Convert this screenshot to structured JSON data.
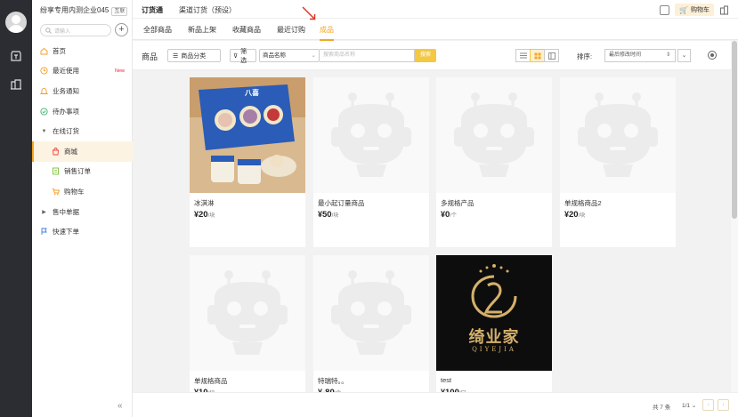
{
  "rail": {
    "icons": [
      "avatar",
      "order-icon",
      "building-icon"
    ]
  },
  "sidebar": {
    "company": "纷享专用内测企业045",
    "company_tag": "互联",
    "search_placeholder": "请输入",
    "add": "+",
    "items": [
      {
        "label": "首页",
        "icon": "home-icon"
      },
      {
        "label": "最近使用",
        "icon": "clock-icon",
        "badge": "New"
      },
      {
        "label": "业务通知",
        "icon": "bell-icon"
      },
      {
        "label": "待办事项",
        "icon": "check-icon"
      },
      {
        "label": "在线订货",
        "icon": "caret-down-icon"
      },
      {
        "label": "商城",
        "icon": "shop-icon"
      },
      {
        "label": "销售订单",
        "icon": "document-icon"
      },
      {
        "label": "购物车",
        "icon": "cart-icon"
      },
      {
        "label": "售中单据",
        "icon": "caret-right-icon"
      },
      {
        "label": "快速下单",
        "icon": "flag-icon"
      }
    ],
    "collapse": "«"
  },
  "header": {
    "app_name": "订货通",
    "channel": "渠道订货（预设）",
    "cart_label": "购物车"
  },
  "tabs": [
    "全部商品",
    "新品上架",
    "收藏商品",
    "最近订购",
    "成品"
  ],
  "toolbar": {
    "title": "商品",
    "category_btn": "商品分类",
    "filter_btn": "筛选",
    "field_select": "商品名称",
    "search_placeholder": "搜索商品名称",
    "search_btn": "搜索",
    "sort_label": "排序:",
    "sort_value": "最后修改时间"
  },
  "products": [
    {
      "name": "冰淇淋",
      "currency": "¥",
      "price": "20",
      "unit": "/块",
      "image": "ice-cream"
    },
    {
      "name": "最小起订量商品",
      "currency": "¥",
      "price": "50",
      "unit": "/块",
      "image": "placeholder"
    },
    {
      "name": "多规格产品",
      "currency": "¥",
      "price": "0",
      "unit": "/个",
      "image": "placeholder"
    },
    {
      "name": "单规格商品2",
      "currency": "¥",
      "price": "20",
      "unit": "/块",
      "image": "placeholder"
    },
    {
      "name": "单规格商品",
      "currency": "¥",
      "price": "10",
      "unit": "/块",
      "image": "placeholder"
    },
    {
      "name": "特瑞特。。",
      "currency": "¥",
      "price": "-80",
      "unit": "/个",
      "image": "placeholder"
    },
    {
      "name": "test",
      "currency": "¥",
      "price": "100",
      "unit": "/只",
      "image": "logo"
    }
  ],
  "logo_text": {
    "cn": "绮业家",
    "en": "QIYEJIA"
  },
  "ice_cream_brand": "八喜",
  "pagination": {
    "total": "共 7 条",
    "page": "1/1",
    "prev": "‹",
    "next": "›"
  },
  "colors": {
    "accent": "#f5a623",
    "rail": "#2b2d33",
    "arrow": "#e0362a"
  }
}
